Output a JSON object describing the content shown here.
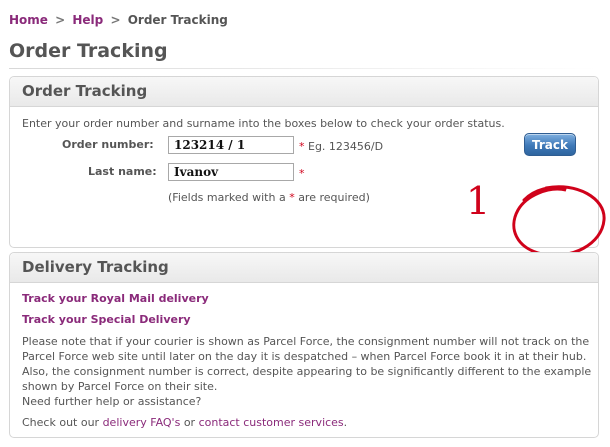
{
  "breadcrumb": {
    "home": "Home",
    "sep1": ">",
    "help": "Help",
    "sep2": ">",
    "current": "Order Tracking"
  },
  "page_title": "Order Tracking",
  "order_panel": {
    "title": "Order Tracking",
    "intro": "Enter your order number and surname into the boxes below to check your order status.",
    "order_number_label": "Order number:",
    "order_number_value": "123214 / 1",
    "order_number_hint": "Eg. 123456/D",
    "last_name_label": "Last name:",
    "last_name_value": "Ivanov",
    "required_marker": "*",
    "required_note_before": "(Fields marked with a",
    "required_note_after": "are required)",
    "track_button": "Track"
  },
  "annotation": {
    "number": "1",
    "color": "#d0021b"
  },
  "delivery_panel": {
    "title": "Delivery Tracking",
    "royal_mail_link": "Track your Royal Mail delivery",
    "special_delivery_link": "Track your Special Delivery",
    "note": "Please note that if your courier is shown as Parcel Force, the consignment number will not track on the Parcel Force web site until later on the day it is despatched – when Parcel Force book it in at their hub. Also, the consignment number is correct, despite appearing to be significantly different to the example shown by Parcel Force on their site.",
    "help_question": "Need further help or assistance?",
    "check_out_prefix": "Check out our",
    "faq_link": "delivery FAQ's",
    "or_text": "or",
    "contact_link": "contact customer services",
    "period": "."
  },
  "colors": {
    "link": "#8a2a7a",
    "required": "#d0021b",
    "button": "#3f79b8",
    "text": "#555555"
  }
}
